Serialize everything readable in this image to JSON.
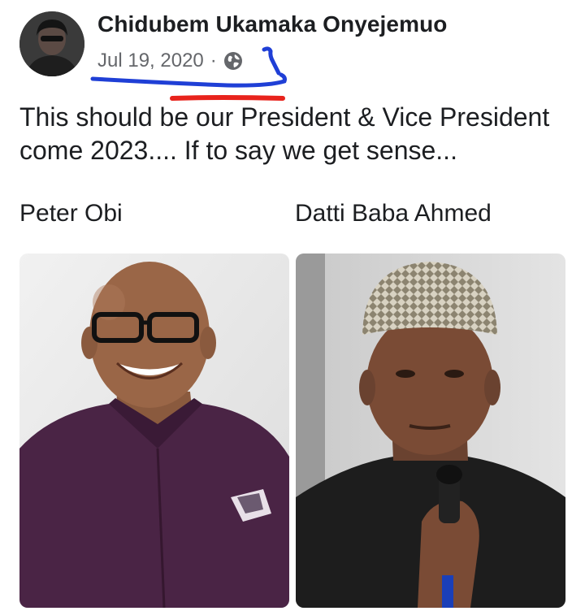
{
  "post": {
    "author_name": "Chidubem Ukamaka Onyejemuo",
    "date": "Jul 19, 2020",
    "separator": "·",
    "privacy_icon": "globe-icon",
    "text_line_1": "This should be our President & Vice President",
    "text_line_2": "come 2023.... If to say we get sense..."
  },
  "photos": [
    {
      "caption": "Peter Obi",
      "icon": "portrait-photo"
    },
    {
      "caption": "Datti Baba Ahmed",
      "icon": "portrait-photo"
    }
  ],
  "colors": {
    "text": "#1c1e21",
    "meta": "#65676b",
    "annotation_blue": "#1f3fd6",
    "annotation_red": "#e8231c"
  }
}
